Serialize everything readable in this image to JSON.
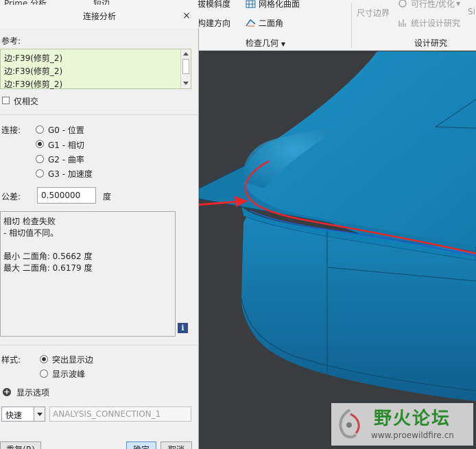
{
  "ribbon": {
    "top_left_partial": "Prime 分析",
    "top_left_partial2": "短边",
    "item_draft": "拔模斜度",
    "item_mesh": "网格化曲面",
    "item_create_dir": "构建方向",
    "item_dihedral": "二面角",
    "group_check_geometry": "检查几何",
    "item_dim_boundary": "尺寸边界",
    "item_feasibility": "可行性/优化",
    "item_stat_design": "统计设计研究",
    "group_design_study": "设计研究",
    "item_si": "Si"
  },
  "dialog": {
    "title": "连接分析",
    "close": "×",
    "references_label": "参考:",
    "references": [
      "边:F39(修剪_2)",
      "边:F39(修剪_2)",
      "边:F39(修剪_2)"
    ],
    "intersect_only": "仅相交",
    "continuity_label": "连接:",
    "continuity_options": [
      "G0 - 位置",
      "G1 - 相切",
      "G2 - 曲率",
      "G3 - 加速度"
    ],
    "continuity_selected": "G1 - 相切",
    "tolerance_label": "公差:",
    "tolerance_value": "0.500000",
    "tolerance_unit": "度",
    "result_line1": "相切 检查失败",
    "result_line2": "- 相切值不同。",
    "result_min": "最小 二面角: 0.5662 度",
    "result_max": "最大 二面角: 0.6179 度",
    "info_icon_glyph": "i",
    "style_label": "样式:",
    "style_options": [
      "突出显示边",
      "显示波峰"
    ],
    "style_selected": "突出显示边",
    "display_options": "显示选项",
    "quick_value": "快速",
    "analysis_name": "ANALYSIS_CONNECTION_1",
    "btn_repeat": "重复(R)",
    "btn_ok": "确定",
    "btn_cancel": "取消"
  },
  "watermark": {
    "title": "野火论坛",
    "url": "www.proewildfire.cn"
  },
  "colors": {
    "model_blue": "#1a83b6",
    "highlight_red": "#e8272a",
    "reference_bg": "#eaf7d6",
    "watermark_green": "#2b8a2b"
  }
}
